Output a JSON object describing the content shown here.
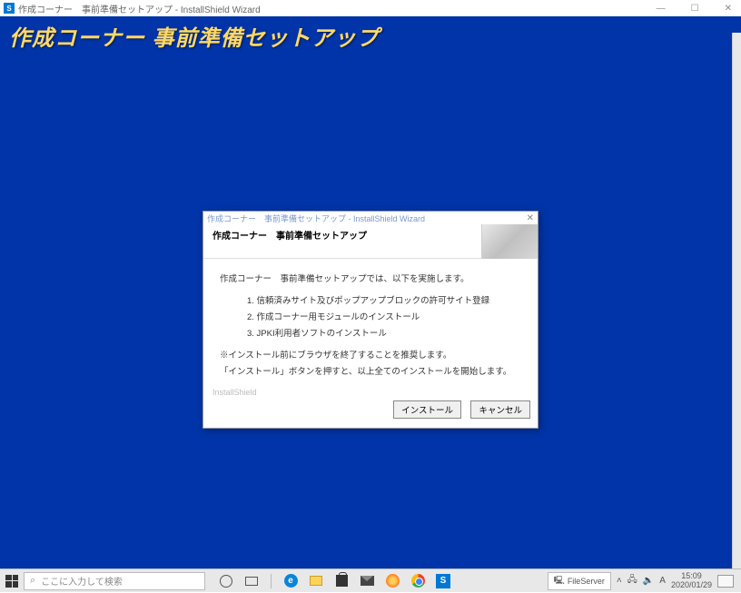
{
  "outerWindow": {
    "title": "作成コーナー　事前準備セットアップ - InstallShield Wizard"
  },
  "banner": "作成コーナー  事前準備セットアップ",
  "dialog": {
    "titlebar": "作成コーナー　事前準備セットアップ - InstallShield Wizard",
    "header": "作成コーナー　事前準備セットアップ",
    "intro": "作成コーナー　事前準備セットアップでは、以下を実施します。",
    "steps": {
      "s1": "1.  信頼済みサイト及びポップアップブロックの許可サイト登録",
      "s2": "2.  作成コーナー用モジュールのインストール",
      "s3": "3.  JPKI利用者ソフトのインストール"
    },
    "note1": "※インストール前にブラウザを終了することを推奨します。",
    "note2": "「インストール」ボタンを押すと、以上全てのインストールを開始します。",
    "footerLabel": "InstallShield",
    "installBtn": "インストール",
    "cancelBtn": "キャンセル"
  },
  "taskbar": {
    "searchPlaceholder": "ここに入力して検索",
    "fileServer": "FileServer",
    "time": "15:09",
    "date": "2020/01/29"
  }
}
